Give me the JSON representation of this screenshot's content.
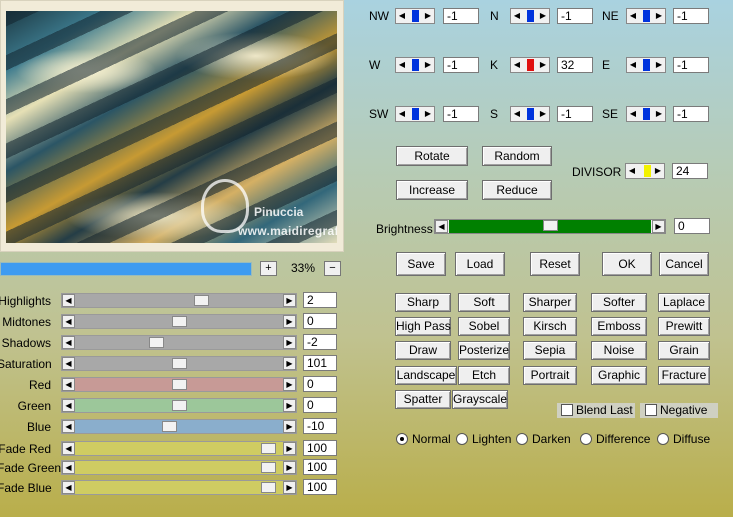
{
  "preview": {
    "watermark_line1": "Pinuccia",
    "watermark_line2": "www.maidiregrafica.eu"
  },
  "zoom": {
    "value": "33%",
    "plus": "+",
    "minus": "−",
    "level": 0.33
  },
  "tone_sliders": [
    {
      "label": "Highlights",
      "value": "2",
      "color": "#a8a8a8",
      "pos": 0.62
    },
    {
      "label": "Midtones",
      "value": "0",
      "color": "#a8a8a8",
      "pos": 0.5
    },
    {
      "label": "Shadows",
      "value": "-2",
      "color": "#a8a8a8",
      "pos": 0.38
    },
    {
      "label": "Saturation",
      "value": "101",
      "color": "#a8a8a8",
      "pos": 0.5
    },
    {
      "label": "Red",
      "value": "0",
      "color": "#c79a96",
      "pos": 0.5
    },
    {
      "label": "Green",
      "value": "0",
      "color": "#9cc79a",
      "pos": 0.5
    },
    {
      "label": "Blue",
      "value": "-10",
      "color": "#8aaecc",
      "pos": 0.45
    },
    {
      "label": "Fade Red",
      "value": "100",
      "color": "#cfcc62",
      "pos": 0.97
    },
    {
      "label": "Fade Green",
      "value": "100",
      "color": "#cfcc62",
      "pos": 0.97
    },
    {
      "label": "Fade Blue",
      "value": "100",
      "color": "#cfcc62",
      "pos": 0.97
    }
  ],
  "matrix": {
    "NW": {
      "label": "NW",
      "value": "-1"
    },
    "N": {
      "label": "N",
      "value": "-1"
    },
    "NE": {
      "label": "NE",
      "value": "-1"
    },
    "W": {
      "label": "W",
      "value": "-1"
    },
    "K": {
      "label": "K",
      "value": "32"
    },
    "E": {
      "label": "E",
      "value": "-1"
    },
    "SW": {
      "label": "SW",
      "value": "-1"
    },
    "S": {
      "label": "S",
      "value": "-1"
    },
    "SE": {
      "label": "SE",
      "value": "-1"
    }
  },
  "matrix_colors": {
    "thumb": "#0033dd",
    "thumb_active": "#e01010",
    "divisor_thumb": "#f2f200"
  },
  "actions": {
    "rotate": "Rotate",
    "random": "Random",
    "increase": "Increase",
    "reduce": "Reduce"
  },
  "divisor": {
    "label": "DIVISOR",
    "value": "24"
  },
  "brightness": {
    "label": "Brightness",
    "value": "0",
    "color": "#008000",
    "level": 0.5
  },
  "dialog_buttons": {
    "save": "Save",
    "load": "Load",
    "reset": "Reset",
    "ok": "OK",
    "cancel": "Cancel"
  },
  "presets": [
    [
      "Sharp",
      "Soft",
      "Sharper",
      "Softer",
      "Laplace"
    ],
    [
      "High Pass",
      "Sobel",
      "Kirsch",
      "Emboss",
      "Prewitt"
    ],
    [
      "Draw",
      "Posterize",
      "Sepia",
      "Noise",
      "Grain"
    ],
    [
      "Landscape",
      "Etch",
      "Portrait",
      "Graphic",
      "Fracture"
    ],
    [
      "Spatter",
      "Grayscale"
    ]
  ],
  "options": {
    "blend_last": "Blend Last",
    "negative": "Negative"
  },
  "blend_modes": {
    "selected": "Normal",
    "items": [
      "Normal",
      "Lighten",
      "Darken",
      "Difference",
      "Diffuse"
    ]
  }
}
